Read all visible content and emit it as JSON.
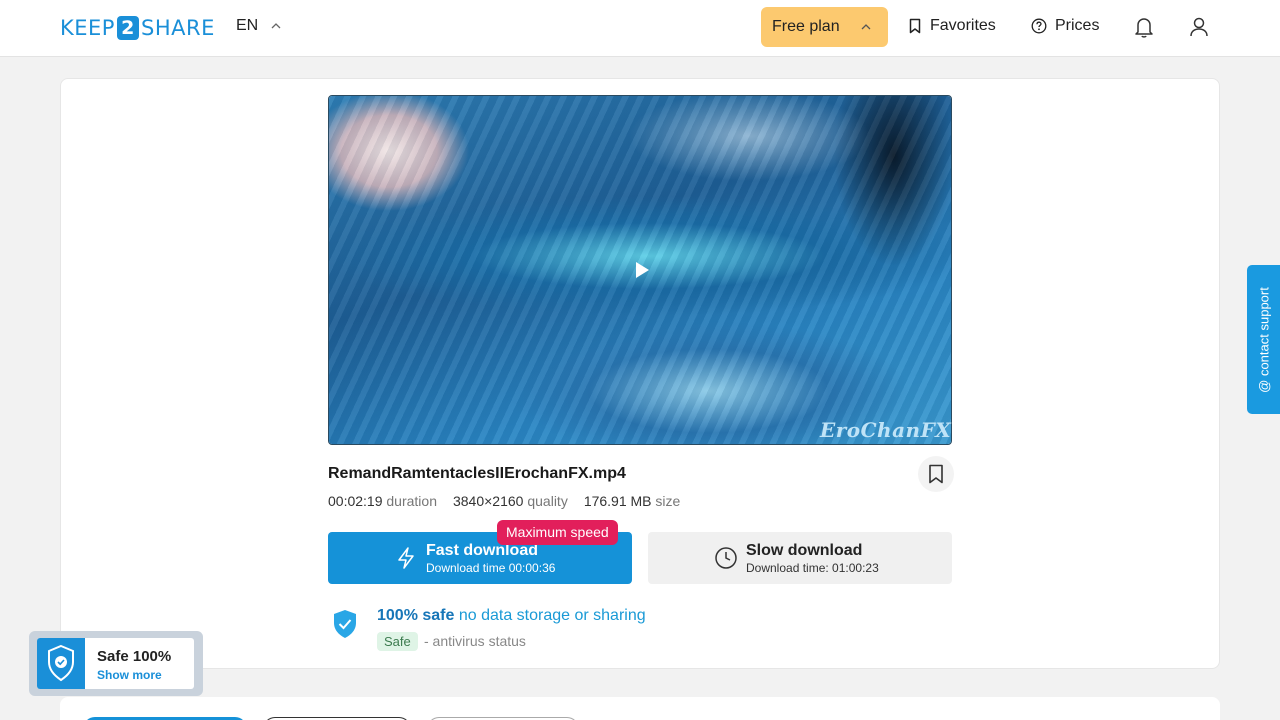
{
  "header": {
    "logo_left": "KEEP",
    "logo_number": "2",
    "logo_right": "SHARE",
    "language": "EN",
    "plan_label": "Free plan",
    "favorites_label": "Favorites",
    "prices_label": "Prices"
  },
  "file": {
    "watermark": "EroChanFX",
    "name": "RemandRamtentaclesIIErochanFX.mp4",
    "duration": "00:02:19",
    "duration_label": "duration",
    "quality": "3840×2160",
    "quality_label": "quality",
    "size": "176.91 MB",
    "size_label": "size"
  },
  "download": {
    "badge": "Maximum speed",
    "fast_title": "Fast download",
    "fast_sub": "Download time 00:00:36",
    "slow_title": "Slow download",
    "slow_sub": "Download time: 01:00:23"
  },
  "safety": {
    "bold": "100% safe",
    "rest": "no data storage or sharing",
    "chip": "Safe",
    "status": "- antivirus status"
  },
  "widget": {
    "title": "Safe 100%",
    "link": "Show more"
  },
  "support": {
    "label": "@ contact support"
  },
  "colors": {
    "brand": "#1a8fd8",
    "plan": "#fcc96f",
    "badge": "#e21f5b"
  }
}
